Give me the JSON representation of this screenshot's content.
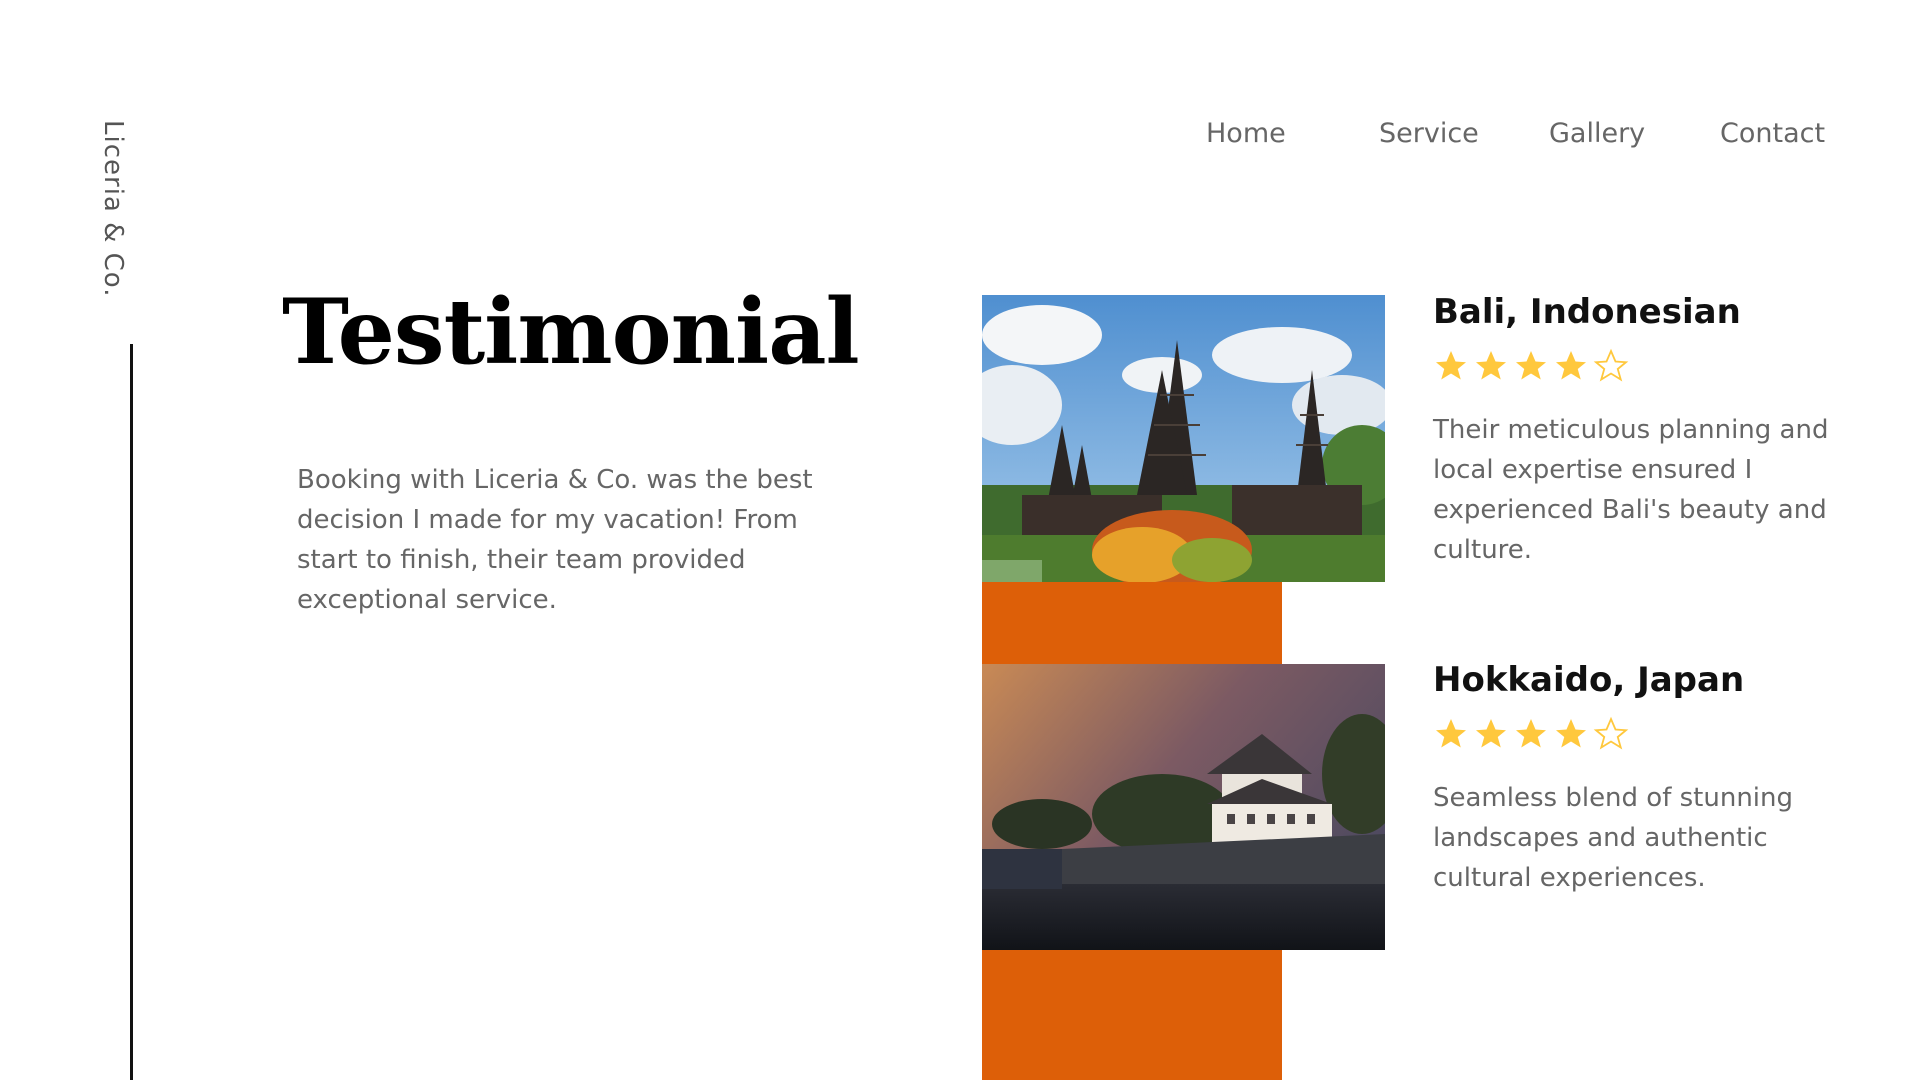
{
  "brand": {
    "name": "Liceria & Co."
  },
  "nav": {
    "items": [
      {
        "label": "Home"
      },
      {
        "label": "Service"
      },
      {
        "label": "Gallery"
      },
      {
        "label": "Contact"
      }
    ]
  },
  "hero": {
    "title": "Testimonial",
    "intro": "Booking with Liceria & Co. was the best decision I made for my vacation! From start to finish, their team provided exceptional service."
  },
  "colors": {
    "accent": "#dd5f08",
    "star": "#ffc83d"
  },
  "testimonials": [
    {
      "location": "Bali, Indonesian",
      "rating": 4,
      "max_rating": 5,
      "text": "Their meticulous planning and local expertise ensured I experienced Bali's beauty and culture.",
      "image_icon": "bali-temple-photo"
    },
    {
      "location": "Hokkaido, Japan",
      "rating": 4,
      "max_rating": 5,
      "text": "Seamless blend of stunning landscapes and authentic cultural experiences.",
      "image_icon": "japan-castle-photo"
    }
  ]
}
